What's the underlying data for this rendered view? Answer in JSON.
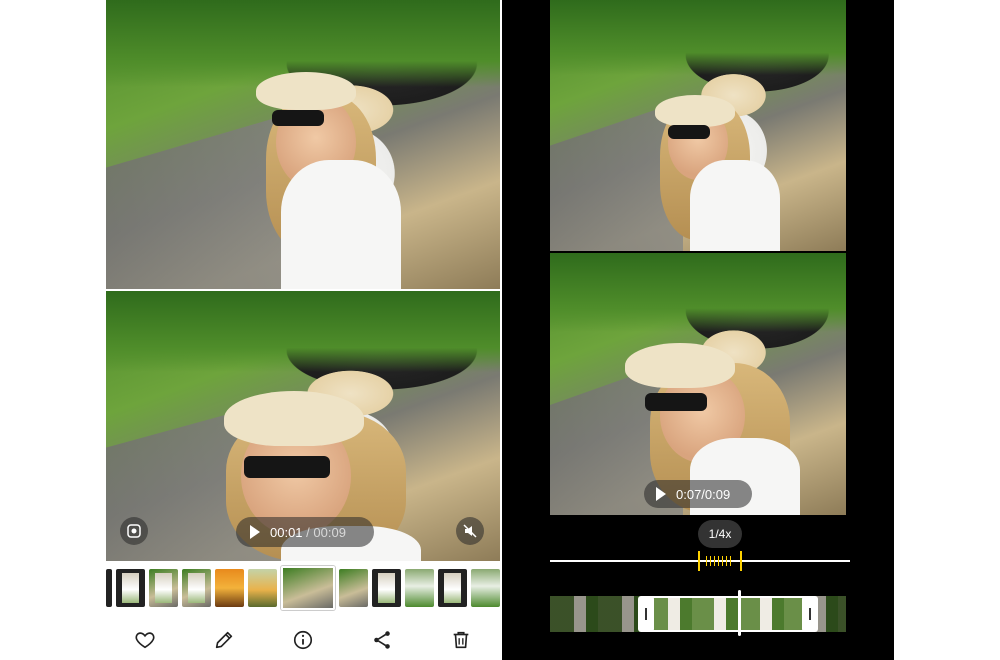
{
  "left_player": {
    "current_time": "00:01",
    "separator": "/",
    "total_time": "00:09"
  },
  "left_toolbar": {
    "items": [
      {
        "name": "favorite",
        "icon": "heart-icon"
      },
      {
        "name": "edit",
        "icon": "pencil-icon"
      },
      {
        "name": "info",
        "icon": "info-icon"
      },
      {
        "name": "share",
        "icon": "share-icon"
      },
      {
        "name": "delete",
        "icon": "trash-icon"
      }
    ]
  },
  "thumb_strip": {
    "count": 14,
    "selected_index": 6
  },
  "right_player": {
    "time_readout": "0:07/0:09",
    "speed_label": "1/4x"
  },
  "colors": {
    "accent_yellow": "#ffd200",
    "dark_bg": "#000000",
    "overlay": "rgba(40,40,40,0.55)"
  }
}
